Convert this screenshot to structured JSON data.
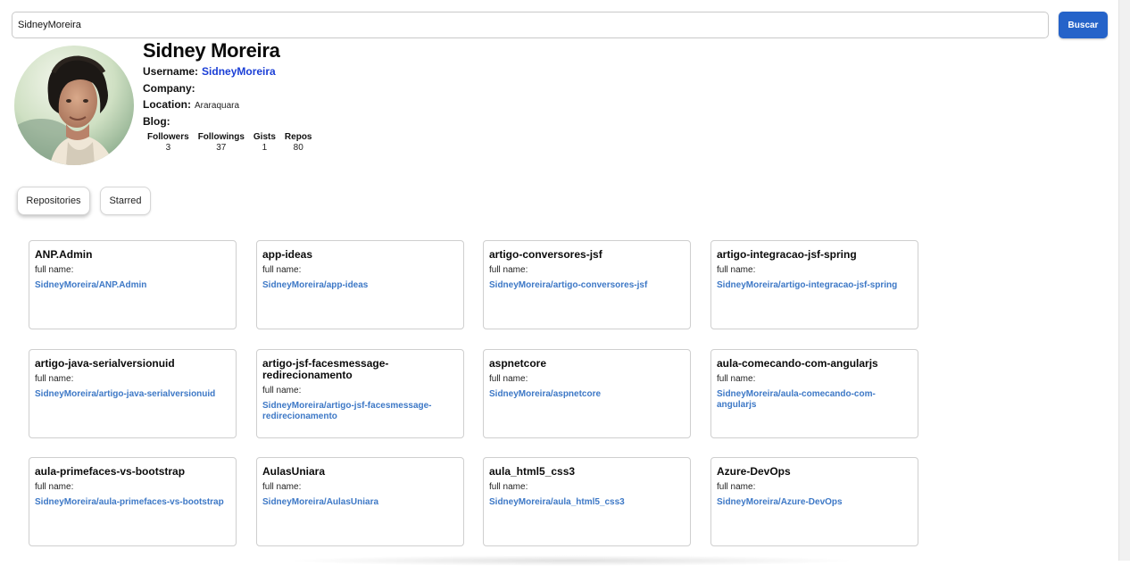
{
  "search": {
    "value": "SidneyMoreira",
    "button_label": "Buscar"
  },
  "profile": {
    "name": "Sidney Moreira",
    "username_label": "Username:",
    "username": "SidneyMoreira",
    "company_label": "Company:",
    "company": "",
    "location_label": "Location:",
    "location": "Araraquara",
    "blog_label": "Blog:",
    "blog": "",
    "stats": [
      {
        "label": "Followers",
        "value": "3"
      },
      {
        "label": "Followings",
        "value": "37"
      },
      {
        "label": "Gists",
        "value": "1"
      },
      {
        "label": "Repos",
        "value": "80"
      }
    ]
  },
  "tabs": {
    "repositories": "Repositories",
    "starred": "Starred"
  },
  "repos": [
    {
      "name": "ANP.Admin",
      "full_name_label": "full name:",
      "full_name": "SidneyMoreira/ANP.Admin"
    },
    {
      "name": "app-ideas",
      "full_name_label": "full name:",
      "full_name": "SidneyMoreira/app-ideas"
    },
    {
      "name": "artigo-conversores-jsf",
      "full_name_label": "full name:",
      "full_name": "SidneyMoreira/artigo-conversores-jsf"
    },
    {
      "name": "artigo-integracao-jsf-spring",
      "full_name_label": "full name:",
      "full_name": "SidneyMoreira/artigo-integracao-jsf-spring"
    },
    {
      "name": "artigo-java-serialversionuid",
      "full_name_label": "full name:",
      "full_name": "SidneyMoreira/artigo-java-serialversionuid"
    },
    {
      "name": "artigo-jsf-facesmessage-redirecionamento",
      "full_name_label": "full name:",
      "full_name": "SidneyMoreira/artigo-jsf-facesmessage-redirecionamento"
    },
    {
      "name": "aspnetcore",
      "full_name_label": "full name:",
      "full_name": "SidneyMoreira/aspnetcore"
    },
    {
      "name": "aula-comecando-com-angularjs",
      "full_name_label": "full name:",
      "full_name": "SidneyMoreira/aula-comecando-com-angularjs"
    },
    {
      "name": "aula-primefaces-vs-bootstrap",
      "full_name_label": "full name:",
      "full_name": "SidneyMoreira/aula-primefaces-vs-bootstrap"
    },
    {
      "name": "AulasUniara",
      "full_name_label": "full name:",
      "full_name": "SidneyMoreira/AulasUniara"
    },
    {
      "name": "aula_html5_css3",
      "full_name_label": "full name:",
      "full_name": "SidneyMoreira/aula_html5_css3"
    },
    {
      "name": "Azure-DevOps",
      "full_name_label": "full name:",
      "full_name": "SidneyMoreira/Azure-DevOps"
    }
  ]
}
